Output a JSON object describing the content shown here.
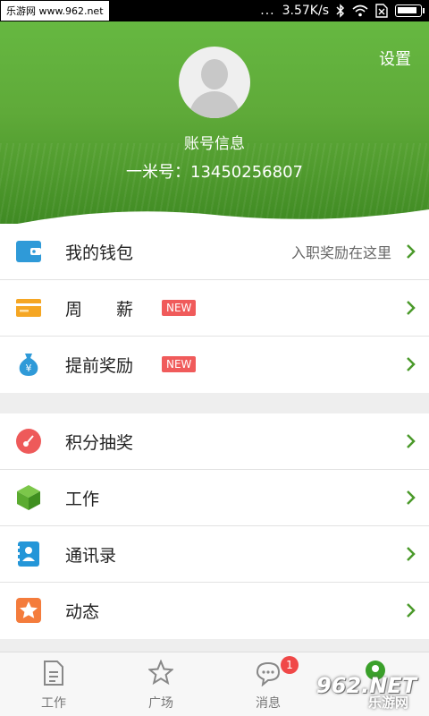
{
  "status_bar": {
    "watermark": "乐游网 www.962.net",
    "speed": "3.57K/s",
    "dots": "...",
    "battery_level": 0.9
  },
  "header": {
    "settings_label": "设置",
    "account_info": "账号信息",
    "yimi_id": "一米号：13450256807"
  },
  "wallet_section": {
    "items": [
      {
        "label": "我的钱包",
        "hint": "入职奖励在这里",
        "icon": "wallet-icon"
      },
      {
        "label": "周　　薪",
        "badge": "NEW",
        "icon": "card-icon"
      },
      {
        "label": "提前奖励",
        "badge": "NEW",
        "icon": "money-bag-icon"
      }
    ]
  },
  "feature_section": {
    "items": [
      {
        "label": "积分抽奖",
        "icon": "lottery-icon"
      },
      {
        "label": "工作",
        "icon": "box-icon"
      },
      {
        "label": "通讯录",
        "icon": "contacts-icon"
      },
      {
        "label": "动态",
        "icon": "star-icon"
      }
    ]
  },
  "bottom_nav": {
    "tabs": [
      {
        "label": "工作",
        "icon": "document-icon"
      },
      {
        "label": "广场",
        "icon": "star-outline-icon"
      },
      {
        "label": "消息",
        "icon": "chat-icon",
        "badge": "1"
      },
      {
        "label": "",
        "icon": "profile-icon"
      }
    ]
  },
  "brand_watermark": {
    "big": "962.NET",
    "small": "乐游网"
  },
  "colors": {
    "header_green": "#5faa39",
    "chevron_green": "#4a9a2a",
    "badge_red": "#f05b5b",
    "wallet_blue": "#2f9ad8",
    "card_orange": "#f5a623",
    "lottery_red": "#ee5a5a",
    "box_green": "#5bab30",
    "contacts_blue": "#2496d8",
    "star_orange": "#f47c3c"
  }
}
